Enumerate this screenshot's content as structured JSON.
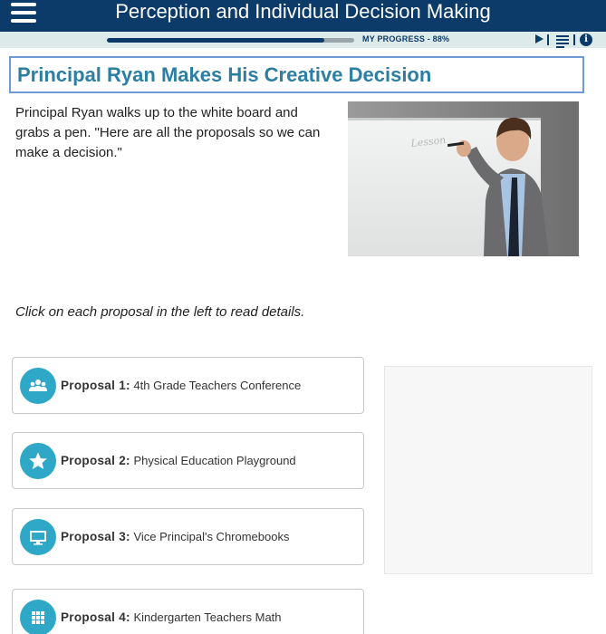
{
  "header": {
    "title": "Perception and Individual Decision Making",
    "menu_icon": "hamburger-icon"
  },
  "progress": {
    "label": "MY PROGRESS - 88%",
    "value": 0.88,
    "controls": [
      "play-icon",
      "list-icon",
      "info-icon"
    ]
  },
  "page": {
    "title": "Principal Ryan Makes His Creative Decision",
    "intro": "Principal Ryan walks up to the white board and grabs a pen. \"Here are all the proposals so we can make a decision.\"",
    "instruction": "Click on each proposal in the left to read details.",
    "photo_board_text": "Lesson"
  },
  "proposals": [
    {
      "label": "Proposal 1",
      "separator": ":",
      "text": " 4th Grade Teachers Conference",
      "icon": "group-icon"
    },
    {
      "label": "Proposal 2",
      "separator": ":",
      "text": " Physical Education Playground",
      "icon": "star-icon"
    },
    {
      "label": "Proposal 3",
      "separator": ":",
      "text": " Vice Principal's Chromebooks",
      "icon": "monitor-icon"
    },
    {
      "label": "Proposal 4",
      "separator": ":",
      "text": " Kindergarten Teachers Math",
      "icon": "grid-icon"
    }
  ],
  "colors": {
    "header_bg": "#0d3b69",
    "progress_bg": "#dcebe9",
    "accent": "#2b7fa3",
    "icon_circle": "#2fa8c7",
    "title_border": "#6f9bd3"
  }
}
